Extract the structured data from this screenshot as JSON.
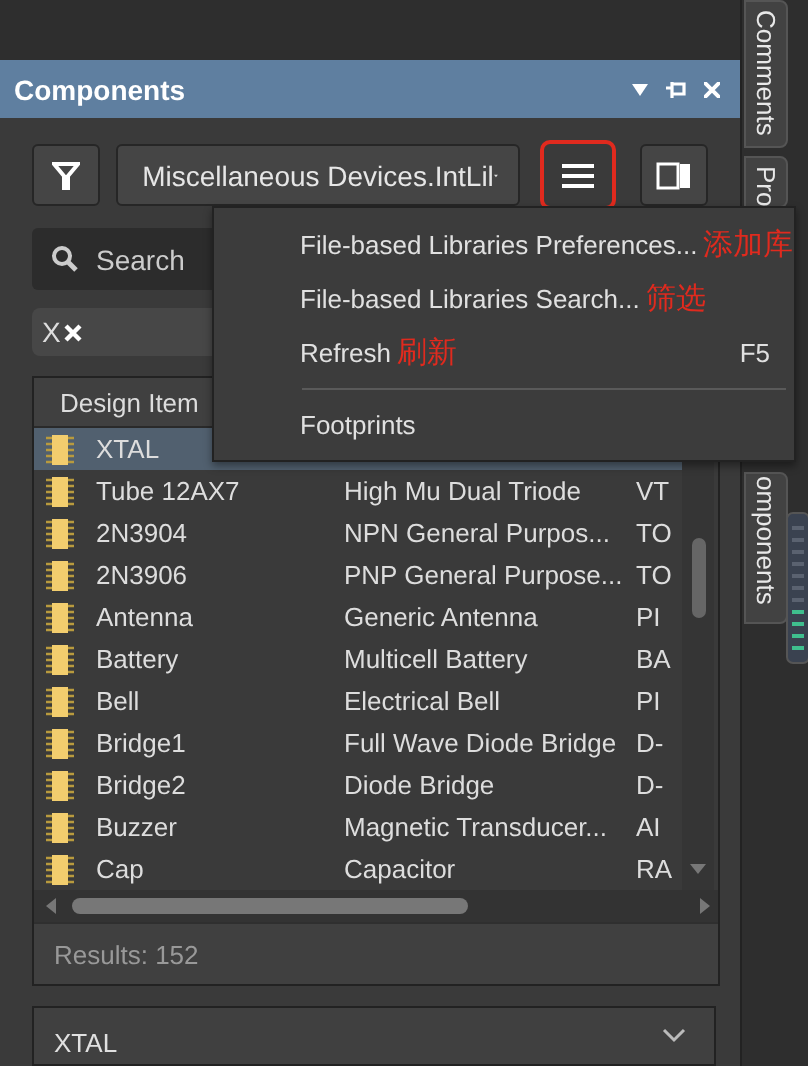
{
  "side_tabs": [
    {
      "label": "Comments"
    },
    {
      "label": "Pro"
    },
    {
      "label": "omponents"
    }
  ],
  "panel": {
    "title": "Components",
    "library": "Miscellaneous Devices.IntLil",
    "menu_button": {
      "annotated": true
    },
    "search_placeholder": "Search",
    "filter_chip": "X"
  },
  "menu": [
    {
      "label": "File-based Libraries Preferences...",
      "note": "添加库",
      "separator_before": false
    },
    {
      "label": "File-based Libraries Search...",
      "note": "筛选",
      "separator_before": false
    },
    {
      "label": "Refresh",
      "note": "刷新",
      "shortcut": "F5",
      "separator_before": false
    },
    {
      "label": "Footprints",
      "separator_before": true
    }
  ],
  "table": {
    "columns": [
      "Design Item"
    ],
    "rows": [
      {
        "name": "XTAL",
        "selected": true
      },
      {
        "name": "Tube 12AX7",
        "description": "High Mu Dual Triode",
        "column_3": "VT",
        "selected": false
      },
      {
        "name": "2N3904",
        "description": "NPN General Purpos...",
        "column_3": "TO",
        "selected": false
      },
      {
        "name": "2N3906",
        "description": "PNP General Purpose...",
        "column_3": "TO",
        "selected": false
      },
      {
        "name": "Antenna",
        "description": "Generic Antenna",
        "column_3": "PI",
        "selected": false
      },
      {
        "name": "Battery",
        "description": "Multicell Battery",
        "column_3": "BA",
        "selected": false
      },
      {
        "name": "Bell",
        "description": "Electrical Bell",
        "column_3": "PI",
        "selected": false
      },
      {
        "name": "Bridge1",
        "description": "Full Wave Diode Bridge",
        "column_3": "D-",
        "selected": false
      },
      {
        "name": "Bridge2",
        "description": "Diode Bridge",
        "column_3": "D-",
        "selected": false
      },
      {
        "name": "Buzzer",
        "description": "Magnetic Transducer...",
        "column_3": "AI",
        "selected": false
      },
      {
        "name": "Cap",
        "description": "Capacitor",
        "column_3": "RA",
        "selected": false
      }
    ]
  },
  "results": "Results: 152",
  "details": {
    "title": "XTAL"
  }
}
